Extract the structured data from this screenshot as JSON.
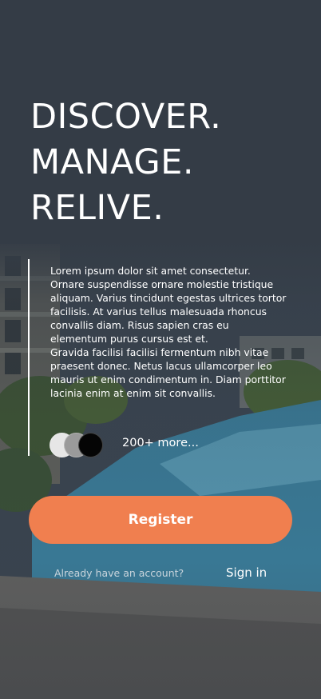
{
  "hero": {
    "lines": [
      "DISCOVER.",
      "MANAGE.",
      "RELIVE."
    ]
  },
  "description": {
    "paragraph1": "Lorem ipsum dolor sit amet consectetur. Ornare suspendisse ornare molestie tristique aliquam. Varius tincidunt egestas ultrices tortor facilisis. At varius tellus malesuada rhoncus convallis diam. Risus sapien cras eu elementum purus cursus est et.",
    "paragraph2": "Gravida facilisi facilisi fermentum nibh vitae praesent donec. Netus lacus ullamcorper leo mauris ut enim condimentum in. Diam porttitor lacinia enim at enim sit convallis."
  },
  "community": {
    "more_text": "200+ more..."
  },
  "actions": {
    "register_label": "Register",
    "account_prompt": "Already have an account?",
    "signin_label": "Sign in"
  },
  "colors": {
    "accent": "#f07f4f",
    "overlay": "#343c46",
    "text": "#ffffff"
  }
}
